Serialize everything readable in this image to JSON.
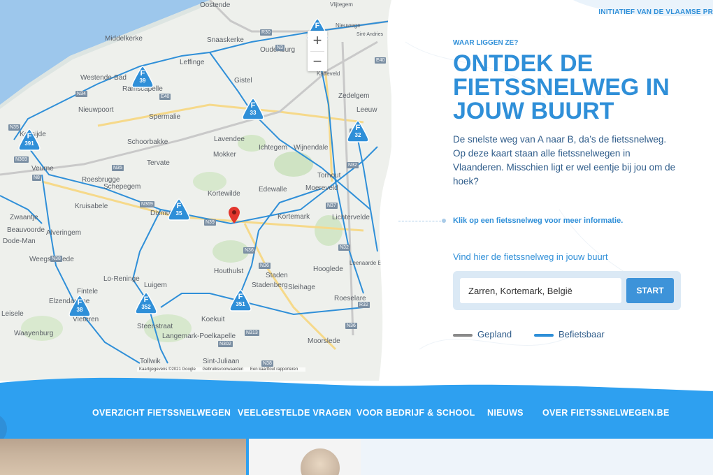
{
  "header": {
    "top_link": "INITIATIEF VAN DE VLAAMSE PR"
  },
  "map": {
    "zoom_in_label": "+",
    "zoom_out_label": "−",
    "attribution": [
      "Kaartgegevens ©2021 Google",
      "Gebruiksvoorwaarden",
      "Een kaartfout rapporteren"
    ],
    "places": [
      "Oostende",
      "Vlijtegem",
      "Nieuwege",
      "Sint-Andries",
      "Middelkerke",
      "Snaaskerke",
      "Oudenburg",
      "Westende-Bad",
      "Leffinge",
      "Ramscapelle",
      "Gistel",
      "Katteveld",
      "Nieuwpoort",
      "Spermalie",
      "Zedelgem",
      "Koksijde",
      "Schoorbakke",
      "Leeuw",
      "Lavendee",
      "Ichtegem",
      "Wijnendale",
      "Tervate",
      "Mokker",
      "Veurne",
      "Roesbrugge",
      "Schepegem",
      "Torhout",
      "Edewalle",
      "Kortewilde",
      "Moereveld",
      "Kruisabele",
      "Dixmuide",
      "Kortemark",
      "Lichtervelde",
      "Zwaantje",
      "Beauvoorde",
      "Alveringem",
      "Dode-Man",
      "Houthulst",
      "Hooglede",
      "Leenaarde Beiloftte",
      "Weegscheede",
      "Lo-Reninge",
      "Sleihage",
      "Fintele",
      "Elzendamme",
      "Luigem",
      "Stadenberg",
      "Roeselare",
      "Leisele",
      "Vleteren",
      "Steenstraat",
      "Koekuit",
      "Waayenburg",
      "Langemark-Poelkapelle",
      "Moorslede",
      "Sint-Juliaan",
      "Tollwik",
      "Staden"
    ],
    "road_tags": [
      "R30",
      "N3",
      "E40",
      "N34",
      "N35",
      "E40",
      "N33",
      "N35",
      "N39",
      "N8",
      "N36",
      "N369",
      "N32",
      "N36",
      "N37",
      "N32",
      "N313",
      "N38",
      "N369",
      "N302",
      "N36",
      "R32",
      "N38"
    ],
    "routes": [
      {
        "letter": "F",
        "number": ""
      },
      {
        "letter": "F",
        "number": "39"
      },
      {
        "letter": "F",
        "number": "33"
      },
      {
        "letter": "F",
        "number": "391"
      },
      {
        "letter": "F",
        "number": "32"
      },
      {
        "letter": "F",
        "number": "35"
      },
      {
        "letter": "F",
        "number": "38"
      },
      {
        "letter": "F",
        "number": "352"
      },
      {
        "letter": "F",
        "number": "351"
      }
    ]
  },
  "panel": {
    "eyebrow": "WAAR LIGGEN ZE?",
    "headline": "ONTDEK DE FIETSSNELWEG IN JOUW BUURT",
    "intro": "De snelste weg van A naar B, da’s de fietssnelweg. Op deze kaart staan alle fietssnelwegen in Vlaanderen. Misschien ligt er wel eentje bij jou om de hoek?",
    "hint": "Klik op een fietssnelweg voor meer informatie.",
    "find_label": "Vind hier de fietssnelweg in jouw buurt",
    "search_value": "Zarren, Kortemark, België",
    "start_label": "START",
    "legend": {
      "planned": "Gepland",
      "rideable": "Befietsbaar"
    }
  },
  "nav": {
    "items": [
      "OVERZICHT FIETSSNELWEGEN",
      "VEELGESTELDE VRAGEN",
      "VOOR BEDRIJF & SCHOOL",
      "NIEUWS",
      "OVER FIETSSNELWEGEN.BE"
    ]
  },
  "colors": {
    "brand_blue": "#2f8fd8",
    "nav_blue": "#2ea0f0",
    "route_blue": "#2f8fd8",
    "planned_grey": "#8a8a8a"
  }
}
